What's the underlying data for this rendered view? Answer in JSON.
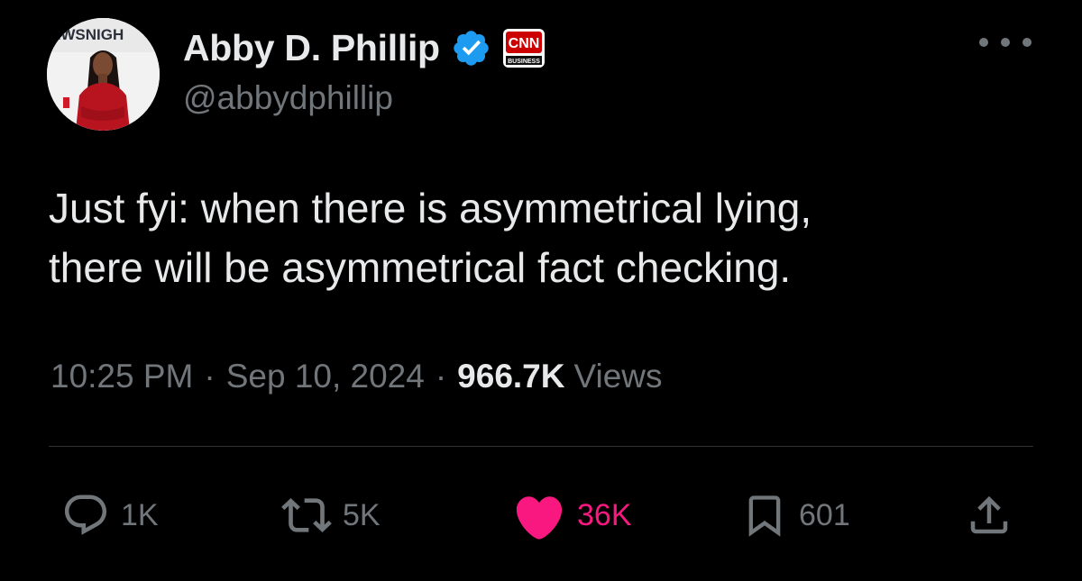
{
  "author": {
    "display_name": "Abby D. Phillip",
    "handle": "@abbydphillip",
    "verified": true,
    "affiliate_badge": "CNN",
    "affiliate_badge_sub": "BUSINESS",
    "avatar_text": "EWSNIGH"
  },
  "tweet": {
    "lines": [
      "Just fyi: when there is asymmetrical lying,",
      "there will be asymmetrical fact checking."
    ],
    "time": "10:25 PM",
    "date": "Sep 10, 2024",
    "separator": "·",
    "views_count": "966.7K",
    "views_label": "Views"
  },
  "actions": {
    "replies": "1K",
    "retweets": "5K",
    "likes": "36K",
    "bookmarks": "601"
  },
  "colors": {
    "background": "#000000",
    "text": "#e7e9ea",
    "muted": "#71767b",
    "verified": "#1d9bf0",
    "like": "#f91880",
    "cnn_red": "#cc0000"
  }
}
